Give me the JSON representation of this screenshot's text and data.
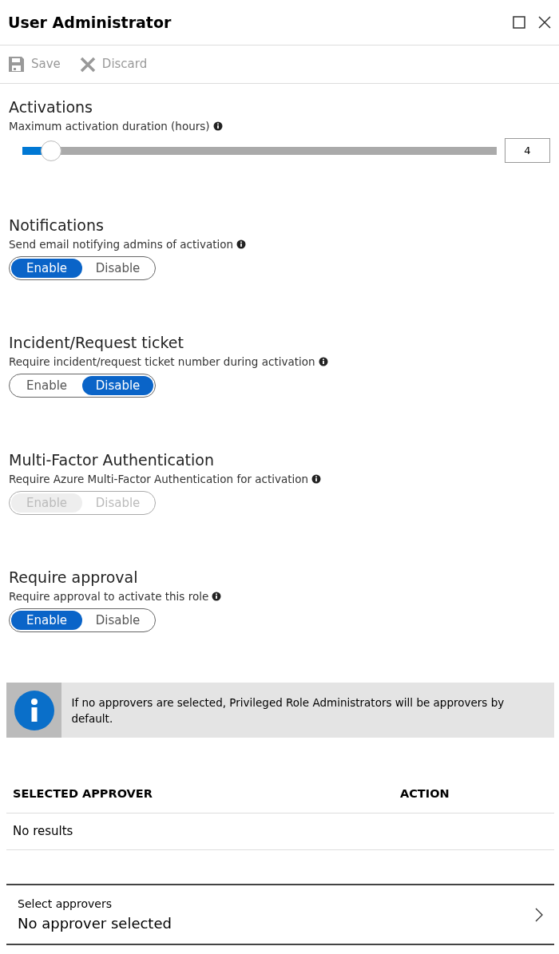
{
  "window": {
    "title": "User Administrator"
  },
  "toolbar": [
    {
      "label": "Save",
      "kind": "save",
      "disabled": true
    },
    {
      "label": "Discard",
      "kind": "discard",
      "disabled": true
    }
  ],
  "sections": [
    {
      "kind": "slider",
      "heading": "Activations",
      "label": "Maximum activation duration (hours)",
      "level": 0.06,
      "value": "4"
    },
    {
      "kind": "toggle",
      "heading": "Notifications",
      "label": "Send email notifying admins of activation",
      "disabled": false,
      "options": [
        {
          "label": "Enable",
          "selected": true
        },
        {
          "label": "Disable",
          "selected": false
        }
      ]
    },
    {
      "kind": "toggle",
      "heading": "Incident/Request ticket",
      "label": "Require incident/request ticket number during activation",
      "disabled": false,
      "options": [
        {
          "label": "Enable",
          "selected": false
        },
        {
          "label": "Disable",
          "selected": true
        }
      ]
    },
    {
      "kind": "toggle",
      "heading": "Multi-Factor Authentication",
      "label": "Require Azure Multi-Factor Authentication for activation",
      "disabled": true,
      "options": [
        {
          "label": "Enable",
          "selected": true
        },
        {
          "label": "Disable",
          "selected": false
        }
      ]
    },
    {
      "kind": "toggle",
      "heading": "Require approval",
      "label": "Require approval to activate this role",
      "disabled": false,
      "options": [
        {
          "label": "Enable",
          "selected": true
        },
        {
          "label": "Disable",
          "selected": false
        }
      ]
    }
  ],
  "info_banner": {
    "text": "If no approvers are selected, Privileged Role Administrators will be approvers by default."
  },
  "table": {
    "columns": [
      "SELECTED APPROVER",
      "ACTION"
    ],
    "empty_text": "No results"
  },
  "picker": {
    "label": "Select approvers",
    "value": "No approver selected"
  }
}
